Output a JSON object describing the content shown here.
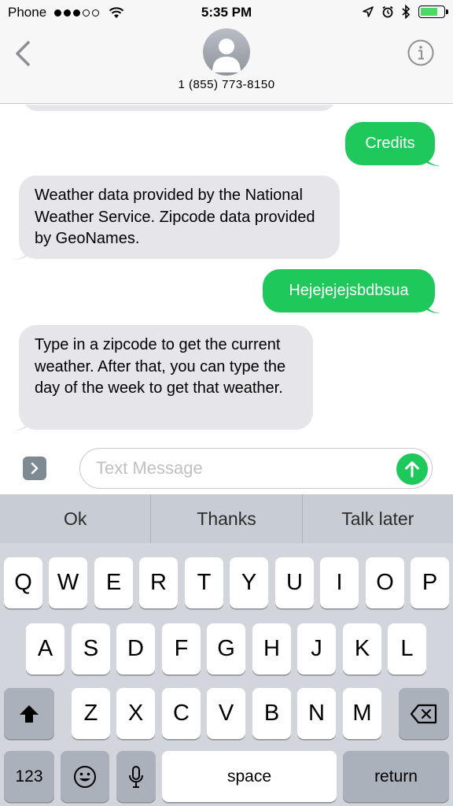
{
  "status_bar": {
    "carrier": "Phone",
    "time": "5:35 PM",
    "battery_level": 0.75,
    "icons": [
      "signal-dots-icon",
      "wifi-icon",
      "location-icon",
      "alarm-icon",
      "bluetooth-icon",
      "battery-icon"
    ]
  },
  "header": {
    "contact_number": "1 (855) 773-8150",
    "icons": [
      "back-chevron-icon",
      "contact-avatar-icon",
      "info-icon"
    ]
  },
  "messages": [
    {
      "direction": "sent",
      "text": "Credits"
    },
    {
      "direction": "received",
      "text": "Weather data provided by the National Weather Service. Zipcode data provided by GeoNames."
    },
    {
      "direction": "sent",
      "text": "Hejejejejsbdbsua"
    },
    {
      "direction": "received",
      "text": "Type in a zipcode to get the current weather. After that, you can type the day of the week to get that weather."
    }
  ],
  "input": {
    "placeholder": "Text Message",
    "value": ""
  },
  "suggestions": [
    "Ok",
    "Thanks",
    "Talk later"
  ],
  "keyboard": {
    "row1": [
      "Q",
      "W",
      "E",
      "R",
      "T",
      "Y",
      "U",
      "I",
      "O",
      "P"
    ],
    "row2": [
      "A",
      "S",
      "D",
      "F",
      "G",
      "H",
      "J",
      "K",
      "L"
    ],
    "row3": [
      "Z",
      "X",
      "C",
      "V",
      "B",
      "N",
      "M"
    ],
    "numbers_label": "123",
    "space_label": "space",
    "return_label": "return"
  },
  "colors": {
    "sent_bubble": "#1ec85a",
    "received_bubble": "#e5e5ea",
    "keyboard_background": "#d2d5db",
    "accent_icon": "#8e8e93"
  }
}
